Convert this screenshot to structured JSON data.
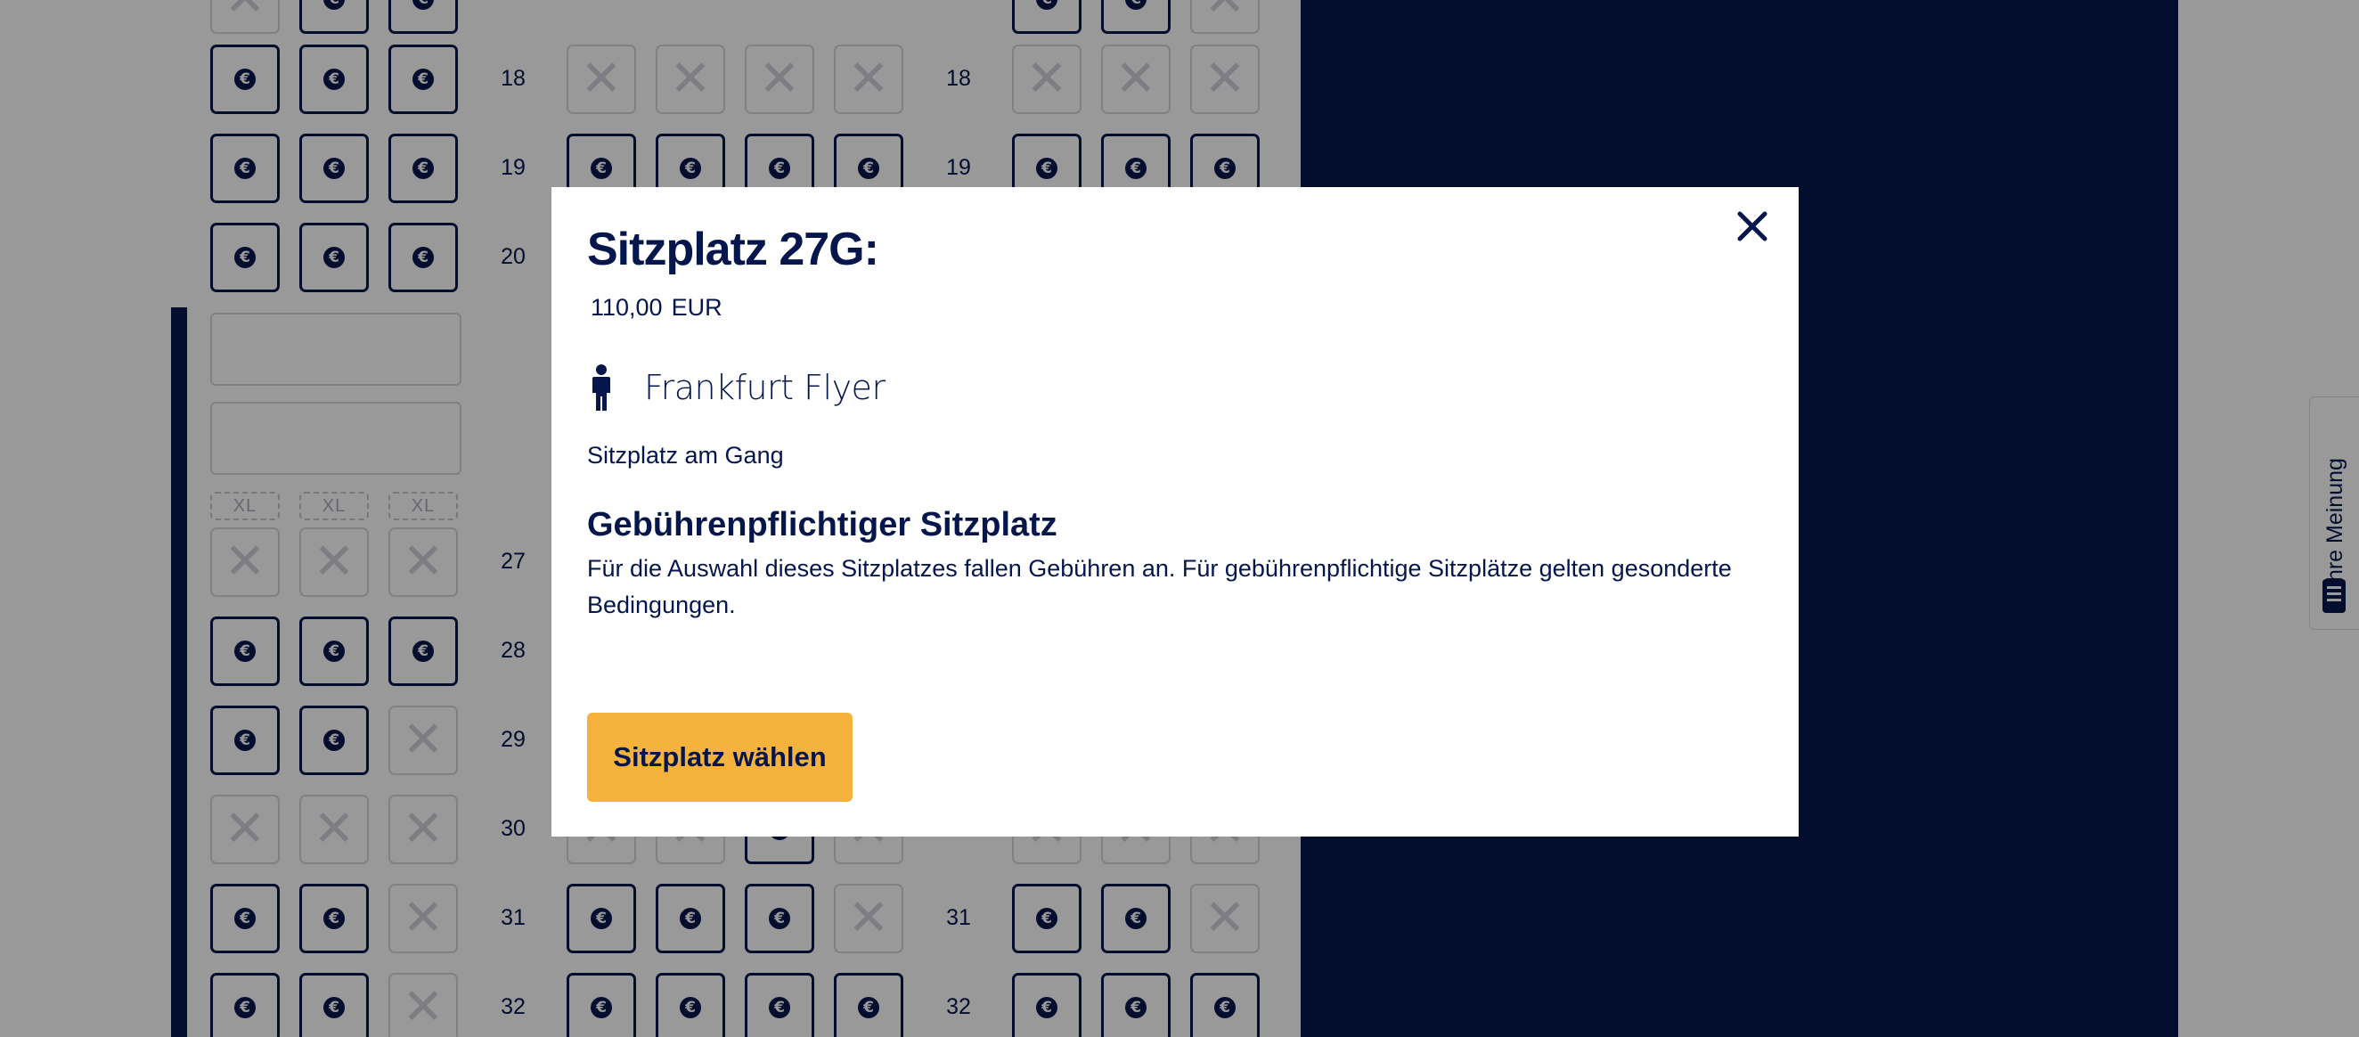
{
  "seatmap": {
    "row_numbers": [
      "18",
      "19",
      "20",
      "27",
      "28",
      "29",
      "30",
      "31",
      "32"
    ],
    "xl_label": "XL",
    "icons": {
      "paid_seat": "euro-icon",
      "unavailable_seat": "x-icon"
    }
  },
  "feedback_tab": {
    "label": "Ihre Meinung",
    "icon": "comment-icon"
  },
  "modal": {
    "title": "Sitzplatz 27G:",
    "price_amount": "110,00",
    "price_currency": "EUR",
    "passenger_icon": "person-icon",
    "passenger_name": "Frankfurt Flyer",
    "seat_type": "Sitzplatz am Gang",
    "fee_heading": "Gebührenpflichtiger Sitzplatz",
    "fee_text": "Für die Auswahl dieses Sitzplatzes fallen Gebühren an. Für gebührenpflichtige Sitzplätze gelten gesonderte Bedingungen.",
    "select_button": "Sitzplatz wählen",
    "close_icon": "close-icon"
  },
  "colors": {
    "brand_navy": "#05164d",
    "button_yellow": "#f5b33d",
    "overlay": "rgba(0,0,0,0.4)"
  }
}
